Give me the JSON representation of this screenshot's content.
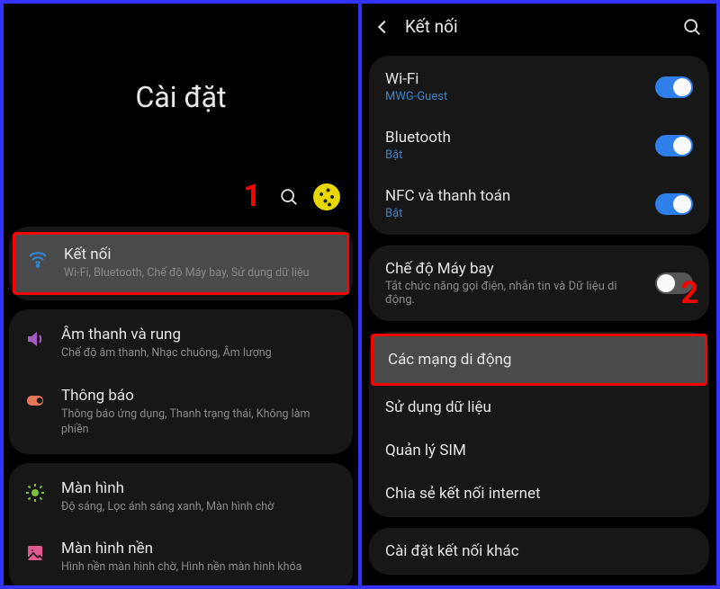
{
  "left": {
    "title": "Cài đặt",
    "step": "1",
    "groups": [
      {
        "items": [
          {
            "icon": "wifi",
            "iconColor": "#2f8adf",
            "title": "Kết nối",
            "sub": "Wi-Fi, Bluetooth, Chế độ Máy bay, Sử dụng dữ liệu",
            "highlight": true
          }
        ]
      },
      {
        "items": [
          {
            "icon": "sound",
            "iconColor": "#a759c4",
            "title": "Âm thanh và rung",
            "sub": "Chế độ âm thanh, Nhạc chuông, Âm lượng"
          },
          {
            "icon": "notif",
            "iconColor": "#e57756",
            "title": "Thông báo",
            "sub": "Thông báo ứng dụng, Thanh trạng thái, Không làm phiền"
          }
        ]
      },
      {
        "items": [
          {
            "icon": "display",
            "iconColor": "#7cc23c",
            "title": "Màn hình",
            "sub": "Độ sáng, Lọc ánh sáng xanh, Màn hình chờ"
          },
          {
            "icon": "wallpaper",
            "iconColor": "#e05a8f",
            "title": "Màn hình nền",
            "sub": "Hình nền màn hình chờ, Hình nền màn hình khóa"
          }
        ]
      }
    ]
  },
  "right": {
    "title": "Kết nối",
    "step": "2",
    "groups": [
      {
        "items": [
          {
            "title": "Wi-Fi",
            "sub": "MWG-Guest",
            "subColor": "blue",
            "toggle": "on"
          },
          {
            "title": "Bluetooth",
            "sub": "Bật",
            "subColor": "blue",
            "toggle": "on"
          },
          {
            "title": "NFC và thanh toán",
            "sub": "Bật",
            "subColor": "blue",
            "toggle": "on"
          }
        ]
      },
      {
        "items": [
          {
            "title": "Chế độ Máy bay",
            "sub": "Tắt chức năng gọi điện, nhắn tin và Dữ liệu di động.",
            "subColor": "gray",
            "toggle": "off"
          }
        ]
      },
      {
        "items": [
          {
            "title": "Các mạng di động",
            "highlight": true
          },
          {
            "title": "Sử dụng dữ liệu"
          },
          {
            "title": "Quản lý SIM"
          },
          {
            "title": "Chia sẻ kết nối internet"
          }
        ]
      },
      {
        "items": [
          {
            "title": "Cài đặt kết nối khác"
          }
        ]
      }
    ]
  }
}
